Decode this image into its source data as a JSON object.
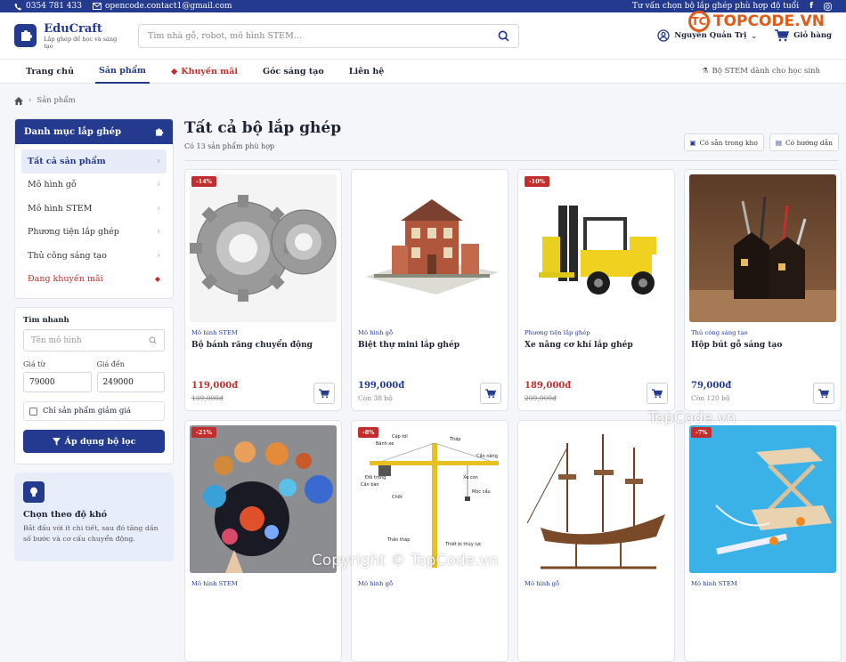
{
  "topbar": {
    "phone": "0354 781 433",
    "email": "opencode.contact1@gmail.com",
    "advice": "Tư vấn chọn bộ lắp ghép phù hợp độ tuổi"
  },
  "header": {
    "brand": "EduCraft",
    "tagline": "Lắp ghép để học và sáng tạo",
    "search_placeholder": "Tìm nhà gỗ, robot, mô hình STEM...",
    "user": "Nguyễn Quản Trị",
    "cart": "Giỏ hàng"
  },
  "watermark": {
    "logo": "TOPCODE.VN",
    "text1": "TopCode.vn",
    "text2": "Copyright © TopCode.vn"
  },
  "nav": {
    "items": [
      "Trang chủ",
      "Sản phẩm",
      "Khuyến mãi",
      "Góc sáng tạo",
      "Liên hệ"
    ],
    "right": "Bộ STEM dành cho học sinh"
  },
  "breadcrumb": {
    "current": "Sản phẩm"
  },
  "sidebar": {
    "title": "Danh mục lắp ghép",
    "items": [
      "Tất cả sản phẩm",
      "Mô hình gỗ",
      "Mô hình STEM",
      "Phương tiện lắp ghép",
      "Thủ công sáng tạo",
      "Đang khuyến mãi"
    ]
  },
  "quick": {
    "title": "Tìm nhanh",
    "name_placeholder": "Tên mô hình",
    "from_label": "Giá từ",
    "to_label": "Giá đến",
    "from_value": "79000",
    "to_value": "249000",
    "discount_only": "Chỉ sản phẩm giảm giá",
    "apply": "Áp dụng bộ lọc"
  },
  "difficulty": {
    "title": "Chọn theo độ khó",
    "desc": "Bắt đầu với ít chi tiết, sau đó tăng dần số bước và cơ cấu chuyển động."
  },
  "main": {
    "title": "Tất cả bộ lắp ghép",
    "subtitle": "Có 13 sản phẩm phù hợp",
    "badge_stock": "Có sẵn trong kho",
    "badge_guide": "Có hướng dẫn"
  },
  "products": [
    {
      "discount": "-14%",
      "category": "Mô hình STEM",
      "name": "Bộ bánh răng chuyển động",
      "price": "119,000đ",
      "sub": "139,000đ"
    },
    {
      "discount": "",
      "category": "Mô hình gỗ",
      "name": "Biệt thự mini lắp ghép",
      "price": "199,000đ",
      "sub": "Còn 38 bộ"
    },
    {
      "discount": "-10%",
      "category": "Phương tiện lắp ghép",
      "name": "Xe nâng cơ khí lắp ghép",
      "price": "189,000đ",
      "sub": "209,000đ"
    },
    {
      "discount": "",
      "category": "Thủ công sáng tạo",
      "name": "Hộp bút gỗ sáng tạo",
      "price": "79,000đ",
      "sub": "Còn 120 bộ"
    },
    {
      "discount": "-21%",
      "category": "Mô hình STEM",
      "name": "",
      "price": "",
      "sub": ""
    },
    {
      "discount": "-8%",
      "category": "Mô hình gỗ",
      "name": "",
      "price": "",
      "sub": ""
    },
    {
      "discount": "",
      "category": "Mô hình gỗ",
      "name": "",
      "price": "",
      "sub": ""
    },
    {
      "discount": "-7%",
      "category": "Mô hình STEM",
      "name": "",
      "price": "",
      "sub": ""
    }
  ],
  "crane_labels": [
    "Cáp tời",
    "Bánh xe",
    "Tháp",
    "Cần bàn",
    "Cần nâng",
    "Đối trọng",
    "Xe con",
    "Móc cẩu",
    "Thân tháp",
    "Thiết bị thủy lực",
    "Chốt"
  ]
}
